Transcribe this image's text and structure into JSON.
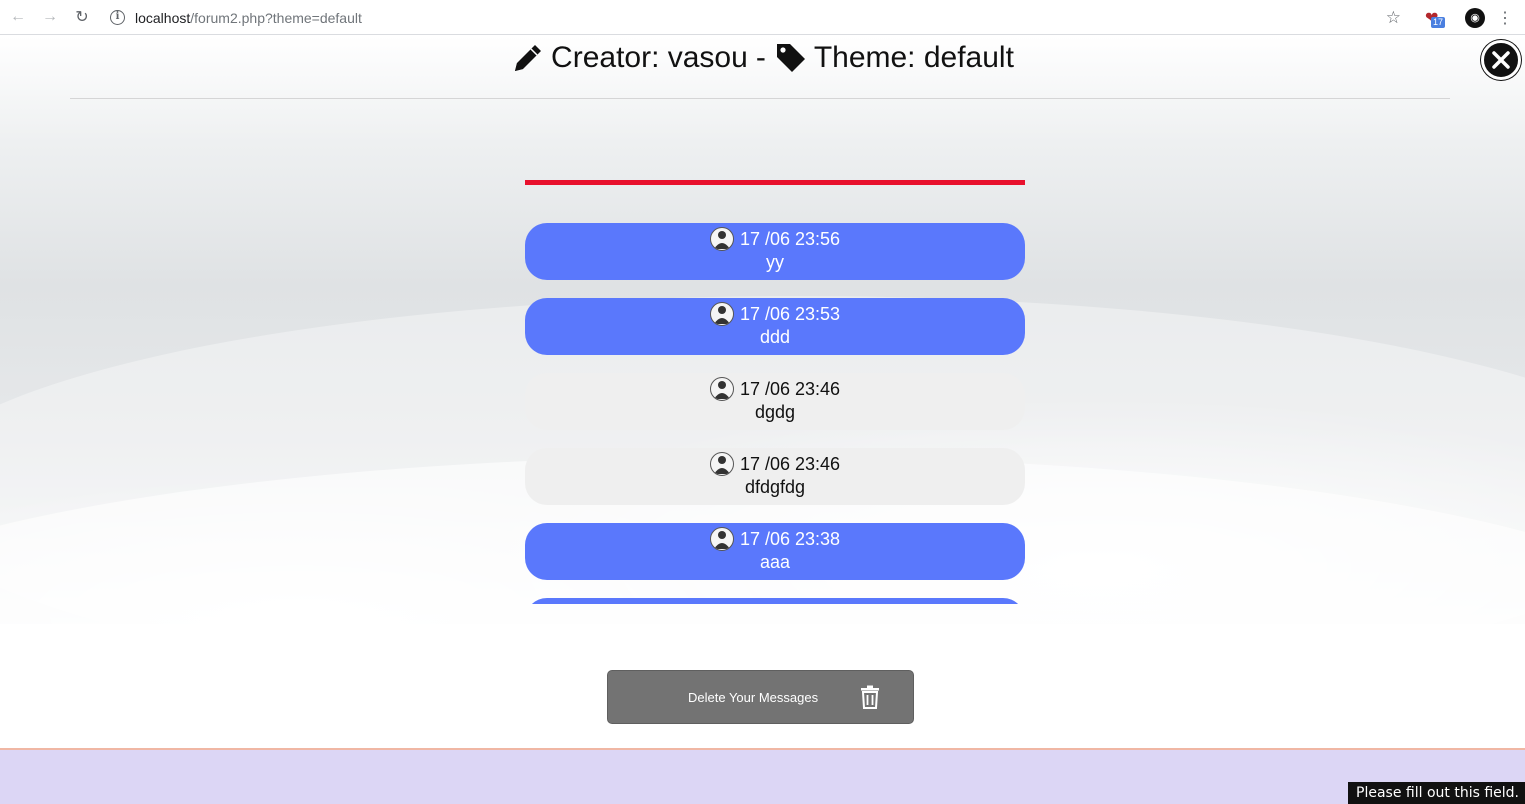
{
  "browser": {
    "back_icon": "←",
    "forward_icon": "→",
    "reload_icon": "↻",
    "url_host": "localhost",
    "url_path": "/forum2.php?theme=default",
    "star_icon": "☆",
    "extension_badge": "17",
    "menu_icon": "⋮"
  },
  "header": {
    "creator_text": "Creator: vasou",
    "separator": "-",
    "theme_text": "Theme: default"
  },
  "messages": [
    {
      "time": "17 /06 23:56",
      "text": "yy",
      "style": "blue"
    },
    {
      "time": "17 /06 23:53",
      "text": "ddd",
      "style": "blue"
    },
    {
      "time": "17 /06 23:46",
      "text": "dgdg",
      "style": "gray"
    },
    {
      "time": "17 /06 23:46",
      "text": "dfdgfdg",
      "style": "gray"
    },
    {
      "time": "17 /06 23:38",
      "text": "aaa",
      "style": "blue"
    },
    {
      "time": "",
      "text": "",
      "style": "blue"
    }
  ],
  "delete_button": {
    "label": "Delete Your Messages"
  },
  "tooltip": {
    "text": "Please fill out this field."
  },
  "colors": {
    "accent_red": "#e8112d",
    "own_message_blue": "#5a78fc",
    "other_message_gray": "#efefef",
    "delete_button_gray": "#737373",
    "footer_lavender": "#dcd6f5"
  }
}
